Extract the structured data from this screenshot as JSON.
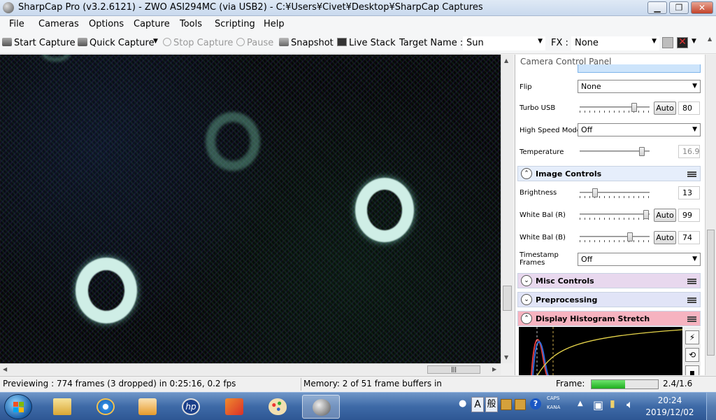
{
  "window": {
    "title": "SharpCap Pro (v3.2.6121) - ZWO ASI294MC (via USB2) - C:¥Users¥Civet¥Desktop¥SharpCap Captures",
    "minimize": "▁",
    "maximize": "❐",
    "close": "✕"
  },
  "menu": [
    "File",
    "Cameras",
    "Options",
    "Capture",
    "Tools",
    "Scripting",
    "Help"
  ],
  "toolbar": {
    "start_capture": "Start Capture",
    "quick_capture": "Quick Capture",
    "stop_capture": "Stop Capture",
    "pause": "Pause",
    "snapshot": "Snapshot",
    "live_stack": "Live Stack",
    "target_name_label": "Target Name :",
    "target_name_value": "Sun",
    "fx_label": "FX :",
    "fx_value": "None"
  },
  "panel": {
    "title": "Camera Control Panel",
    "flip": {
      "label": "Flip",
      "value": "None"
    },
    "turbo_usb": {
      "label": "Turbo USB",
      "auto": "Auto",
      "value": "80",
      "level": 0.8
    },
    "high_speed_mode": {
      "label": "High Speed Mode",
      "value": "Off"
    },
    "temperature": {
      "label": "Temperature",
      "value": "16.9",
      "level": 0.92
    },
    "image_controls": {
      "title": "Image Controls",
      "chevron": "⌃"
    },
    "brightness": {
      "label": "Brightness",
      "value": "13",
      "level": 0.2
    },
    "white_bal_r": {
      "label": "White Bal (R)",
      "auto": "Auto",
      "value": "99",
      "level": 0.99
    },
    "white_bal_b": {
      "label": "White Bal (B)",
      "auto": "Auto",
      "value": "74",
      "level": 0.74
    },
    "timestamp_frames": {
      "label": "Timestamp\nFrames",
      "value": "Off"
    },
    "misc_controls": {
      "title": "Misc Controls",
      "chevron": "⌄"
    },
    "preprocessing": {
      "title": "Preprocessing",
      "chevron": "⌄"
    },
    "display_histogram_stretch": {
      "title": "Display Histogram Stretch",
      "chevron": "⌃"
    }
  },
  "status": {
    "previewing": "Previewing : 774 frames (3 dropped) in 0:25:16, 0.2 fps",
    "memory": "Memory: 2 of 51 frame buffers in",
    "frame_label": "Frame:",
    "frame_value": "2.4/1.6",
    "frame_fill": 0.5
  },
  "taskbar": {
    "ime_lang": "A",
    "ime_mode": "般",
    "caps": "CAPS",
    "kana": "KANA",
    "time": "20:24",
    "date": "2019/12/02"
  },
  "colors": {
    "misc_controls_bg": "#e8d8ee",
    "preprocessing_bg": "#e1e4f7",
    "histogram_bg": "#f6b3c0",
    "image_controls_bg": "#e6eefb",
    "frame_bar": "#2ec42e"
  },
  "icons": [
    "start-capture-icon",
    "quick-capture-icon",
    "stop-icon",
    "pause-icon",
    "snapshot-icon",
    "live-stack-icon",
    "windows-start-icon",
    "file-explorer-icon",
    "internet-explorer-icon",
    "media-player-icon",
    "hp-icon",
    "package-icon",
    "paint-icon",
    "sharpcap-icon"
  ]
}
